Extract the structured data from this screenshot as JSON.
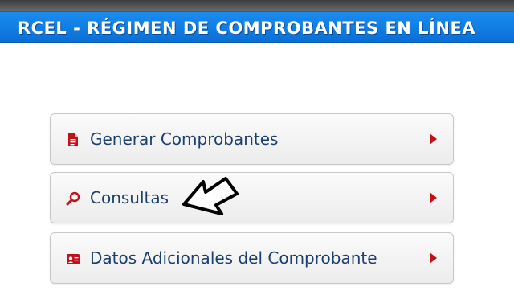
{
  "header": {
    "title": "RCEL - RÉGIMEN DE COMPROBANTES EN LÍNEA"
  },
  "menu": {
    "items": [
      {
        "label": "Generar Comprobantes",
        "icon": "document-icon"
      },
      {
        "label": "Consultas",
        "icon": "search-icon"
      },
      {
        "label": "Datos Adicionales del Comprobante",
        "icon": "id-card-icon"
      }
    ]
  },
  "colors": {
    "banner": "#0a6fd6",
    "banner_text": "#ffffff",
    "menu_text": "#1c3f6e",
    "accent_red": "#c1121c"
  }
}
